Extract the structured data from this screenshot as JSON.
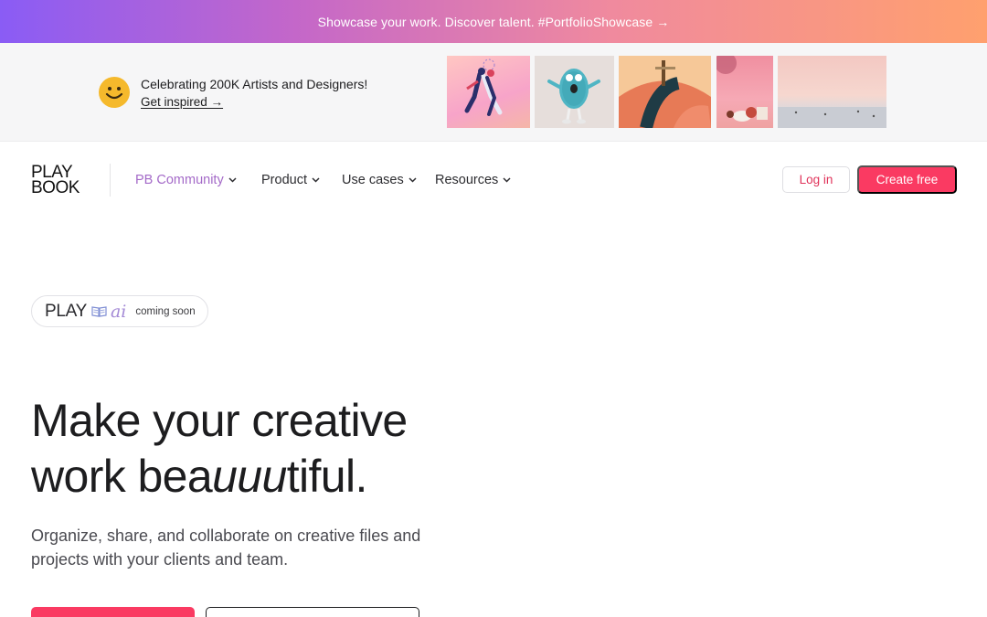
{
  "top_banner": {
    "text": "Showcase your work. Discover talent. #PortfolioShowcase →"
  },
  "promo": {
    "icon": "smiley-face-icon",
    "title": "Celebrating 200K Artists and Designers!",
    "link": "Get inspired →",
    "thumbnails": [
      "dancing-couple-illustration",
      "fuzzy-blue-monster-character",
      "orange-dome-3d-art",
      "pink-still-life-photo",
      "pastel-beach-photo"
    ]
  },
  "nav": {
    "logo_line1": "PLAY",
    "logo_line2": "BOOK",
    "items": [
      {
        "label": "PB Community",
        "active": true
      },
      {
        "label": "Product"
      },
      {
        "label": "Use cases"
      },
      {
        "label": "Resources"
      }
    ],
    "chevron": "⌄",
    "login": "Log in",
    "create": "Create free"
  },
  "ai_badge": {
    "play": "PLAY",
    "ai": "ai",
    "status": "coming soon"
  },
  "hero": {
    "title_line1": "Make your creative",
    "title_line2_pre": "work bea",
    "title_line2_em": "uuu",
    "title_line2_post": "tiful.",
    "subtitle": "Organize, share, and collaborate on creative files and projects with your clients and team."
  },
  "colors": {
    "accent": "#fa3a62",
    "community_purple": "#a46ac8",
    "banner_start": "#8a5cf5",
    "banner_end": "#ffa06e",
    "smiley": "#f5b92c"
  }
}
